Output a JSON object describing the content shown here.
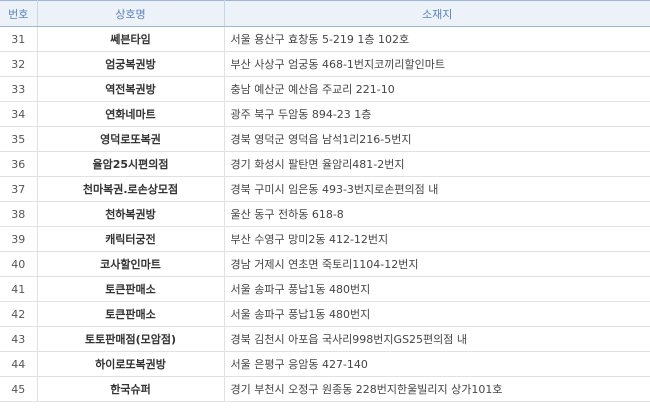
{
  "header": {
    "num": "번호",
    "name": "상호명",
    "address": "소재지"
  },
  "rows": [
    {
      "num": "31",
      "name": "쎄븐타임",
      "address": "서울 용산구 효창동 5-219 1층 102호"
    },
    {
      "num": "32",
      "name": "엄궁복권방",
      "address": "부산 사상구 엄궁동 468-1번지코끼리할인마트"
    },
    {
      "num": "33",
      "name": "역전복권방",
      "address": "충남 예산군 예산읍 주교리 221-10"
    },
    {
      "num": "34",
      "name": "연화네마트",
      "address": "광주 북구 두암동 894-23 1층"
    },
    {
      "num": "35",
      "name": "영덕로또복권",
      "address": "경북 영덕군 영덕읍 남석1리216-5번지"
    },
    {
      "num": "36",
      "name": "율암25시편의점",
      "address": "경기 화성시 팔탄면 율암리481-2번지"
    },
    {
      "num": "37",
      "name": "천마복권.로손상모점",
      "address": "경북 구미시 임은동 493-3번지로손편의점 내"
    },
    {
      "num": "38",
      "name": "천하복권방",
      "address": "울산 동구 전하동 618-8"
    },
    {
      "num": "39",
      "name": "캐릭터궁전",
      "address": "부산 수영구 망미2동 412-12번지"
    },
    {
      "num": "40",
      "name": "코사할인마트",
      "address": "경남 거제시 연초면 죽토리1104-12번지"
    },
    {
      "num": "41",
      "name": "토큰판매소",
      "address": "서울 송파구 풍납1동 480번지"
    },
    {
      "num": "42",
      "name": "토큰판매소",
      "address": "서울 송파구 풍납1동 480번지"
    },
    {
      "num": "43",
      "name": "토토판매점(모암점)",
      "address": "경북 김천시 아포읍 국사리998번지GS25편의점 내"
    },
    {
      "num": "44",
      "name": "하이로또복권방",
      "address": "서울 은평구 응암동 427-140"
    },
    {
      "num": "45",
      "name": "한국슈퍼",
      "address": "경기 부천시 오정구 원종동 228번지한울빌리지 상가101호"
    }
  ]
}
